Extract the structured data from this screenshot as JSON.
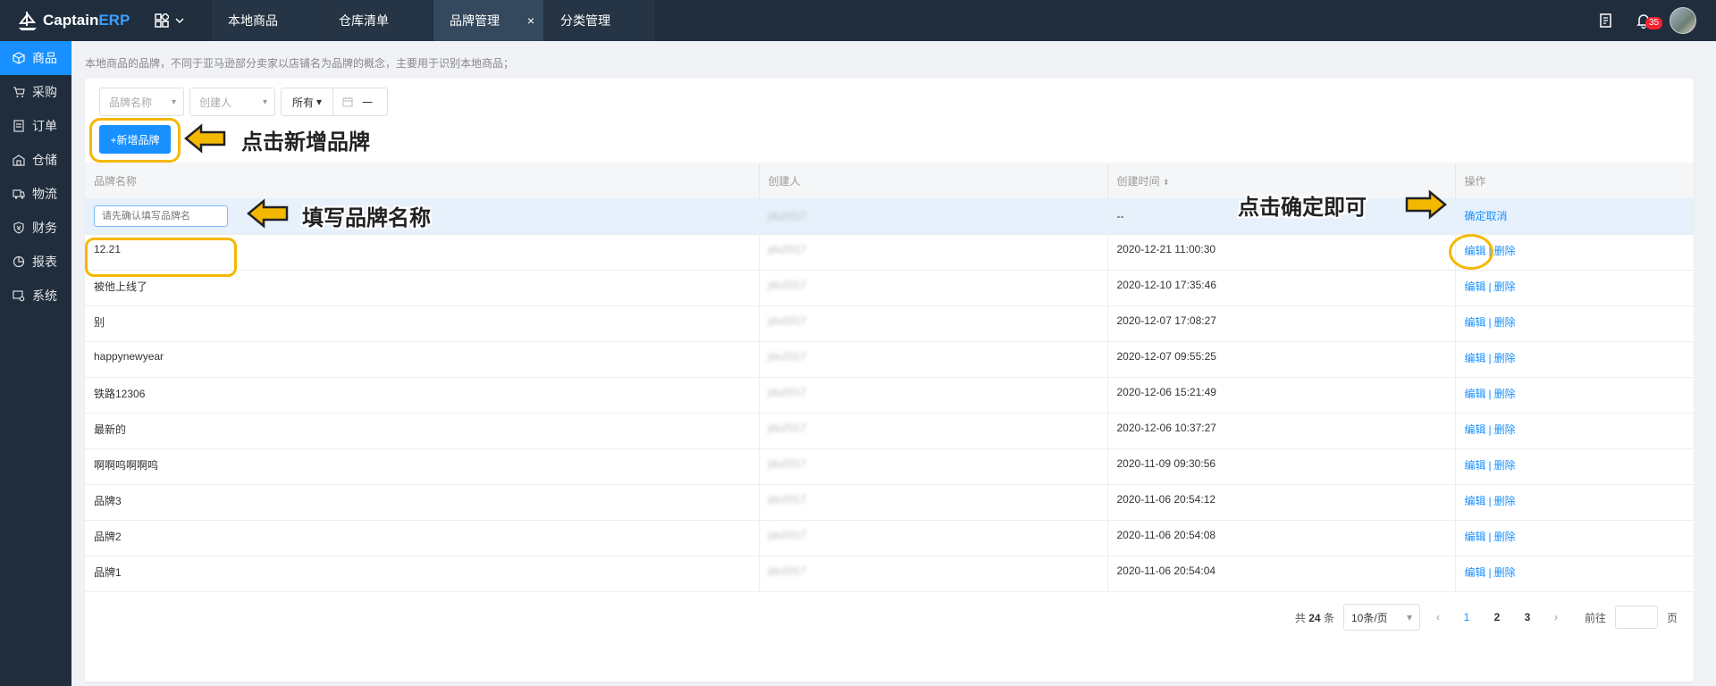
{
  "app": {
    "brand_a": "Captain",
    "brand_b": "ERP",
    "notification_count": "35"
  },
  "tabs": [
    {
      "label": "本地商品"
    },
    {
      "label": "仓库清单"
    },
    {
      "label": "品牌管理",
      "close": "×"
    },
    {
      "label": "分类管理"
    }
  ],
  "sidebar": [
    {
      "label": "商品",
      "icon": "cube-icon"
    },
    {
      "label": "采购",
      "icon": "cart-icon"
    },
    {
      "label": "订单",
      "icon": "order-icon"
    },
    {
      "label": "仓储",
      "icon": "warehouse-icon"
    },
    {
      "label": "物流",
      "icon": "truck-icon"
    },
    {
      "label": "财务",
      "icon": "finance-icon"
    },
    {
      "label": "报表",
      "icon": "chart-icon"
    },
    {
      "label": "系统",
      "icon": "settings-icon"
    }
  ],
  "hint": "本地商品的品牌，不同于亚马逊部分卖家以店铺名为品牌的概念，主要用于识别本地商品；",
  "filters": {
    "brand_placeholder": "品牌名称",
    "creator_placeholder": "创建人",
    "date_scope": "所有",
    "date_sep": "一"
  },
  "add_button": "+新增品牌",
  "columns": {
    "name": "品牌名称",
    "creator": "创建人",
    "created": "创建时间",
    "actions": "操作"
  },
  "edit_row": {
    "placeholder": "请先确认填写品牌名",
    "creator": "jdu2017",
    "created": "--",
    "confirm": "确定",
    "cancel": "取消"
  },
  "rows": [
    {
      "name": "12.21",
      "creator": "jdu2017",
      "created": "2020-12-21 11:00:30"
    },
    {
      "name": "被他上线了",
      "creator": "jdu2017",
      "created": "2020-12-10 17:35:46"
    },
    {
      "name": "别",
      "creator": "jdu2017",
      "created": "2020-12-07 17:08:27"
    },
    {
      "name": "happynewyear",
      "creator": "jdu2017",
      "created": "2020-12-07 09:55:25"
    },
    {
      "name": "铁路12306",
      "creator": "jdu2017",
      "created": "2020-12-06 15:21:49"
    },
    {
      "name": "最新的",
      "creator": "jdu2017",
      "created": "2020-12-06 10:37:27"
    },
    {
      "name": "啊啊呜啊啊呜",
      "creator": "jdu2017",
      "created": "2020-11-09 09:30:56"
    },
    {
      "name": "品牌3",
      "creator": "jdu2017",
      "created": "2020-11-06 20:54:12"
    },
    {
      "name": "品牌2",
      "creator": "jdu2017",
      "created": "2020-11-06 20:54:08"
    },
    {
      "name": "品牌1",
      "creator": "jdu2017",
      "created": "2020-11-06 20:54:04"
    }
  ],
  "row_actions": {
    "edit": "编辑",
    "delete": "删除",
    "sep": "|"
  },
  "annotations": {
    "add": "点击新增品牌",
    "fill": "填写品牌名称",
    "confirm": "点击确定即可"
  },
  "pagination": {
    "total_prefix": "共",
    "total": "24",
    "total_suffix": "条",
    "page_size": "10条/页",
    "pages": [
      "1",
      "2",
      "3"
    ],
    "goto_prefix": "前往",
    "goto_suffix": "页"
  },
  "colors": {
    "accent": "#1890ff",
    "sidebar_bg": "#1f2d3d",
    "highlight": "#f5b800"
  }
}
